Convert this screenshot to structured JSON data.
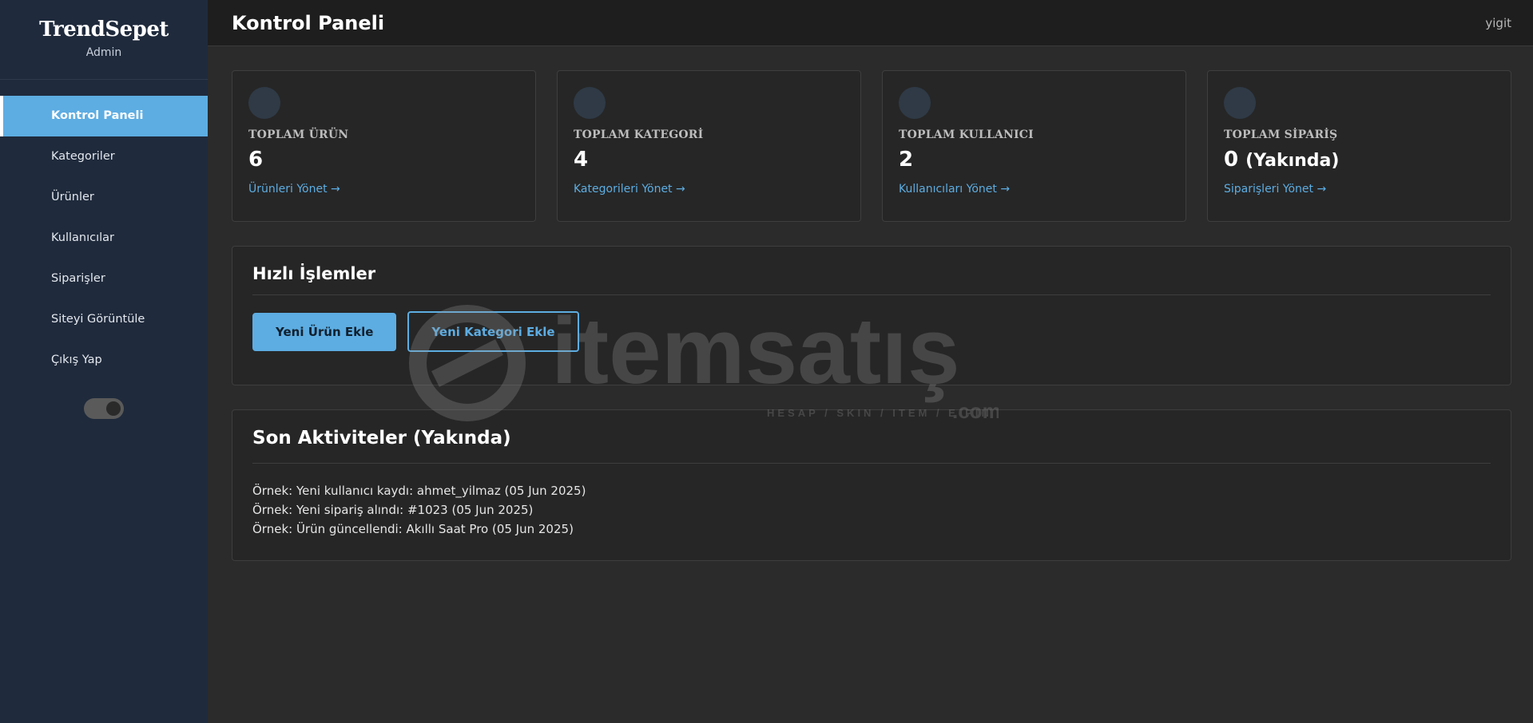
{
  "sidebar": {
    "brand": "TrendSepet",
    "role": "Admin",
    "items": [
      {
        "label": "Kontrol Paneli",
        "active": true
      },
      {
        "label": "Kategoriler"
      },
      {
        "label": "Ürünler"
      },
      {
        "label": "Kullanıcılar"
      },
      {
        "label": "Siparişler"
      },
      {
        "label": "Siteyi Görüntüle"
      },
      {
        "label": "Çıkış Yap"
      }
    ],
    "theme_toggle": {
      "on": true
    }
  },
  "header": {
    "title": "Kontrol Paneli",
    "user": "yigit"
  },
  "stats": [
    {
      "label": "TOPLAM ÜRÜN",
      "value": "6",
      "suffix": "",
      "link": "Ürünleri Yönet →"
    },
    {
      "label": "TOPLAM KATEGORİ",
      "value": "4",
      "suffix": "",
      "link": "Kategorileri Yönet →"
    },
    {
      "label": "TOPLAM KULLANICI",
      "value": "2",
      "suffix": "",
      "link": "Kullanıcıları Yönet →"
    },
    {
      "label": "TOPLAM SİPARİŞ",
      "value": "0",
      "suffix": "(Yakında)",
      "link": "Siparişleri Yönet →"
    }
  ],
  "quick_actions": {
    "title": "Hızlı İşlemler",
    "add_product": "Yeni Ürün Ekle",
    "add_category": "Yeni Kategori Ekle"
  },
  "activity": {
    "title": "Son Aktiviteler (Yakında)",
    "items": [
      "Örnek: Yeni kullanıcı kaydı: ahmet_yilmaz (05 Jun 2025)",
      "Örnek: Yeni sipariş alındı: #1023 (05 Jun 2025)",
      "Örnek: Ürün güncellendi: Akıllı Saat Pro (05 Jun 2025)"
    ]
  },
  "watermark": {
    "name": "itemsatış",
    "tagline": "HESAP / SKIN / ITEM / E-PIN",
    "domain": ".com"
  },
  "colors": {
    "accent": "#5dade2",
    "sidebar_bg": "#1f2a3c",
    "main_bg": "#2b2b2b",
    "card_bg": "#262626"
  }
}
